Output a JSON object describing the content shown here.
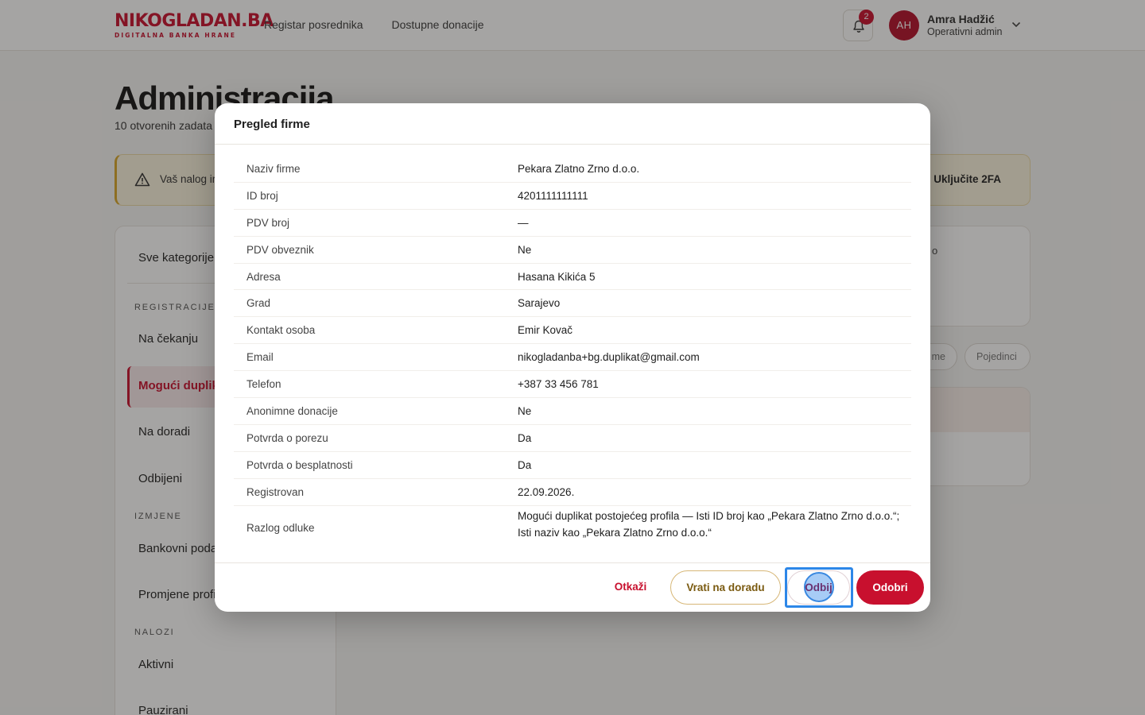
{
  "header": {
    "logo_main_a": "NIKO",
    "logo_main_b": "GLADAN.BA",
    "logo_sub": "DIGITALNA BANKA HRANE",
    "nav": [
      "Registar posrednika",
      "Dostupne donacije"
    ],
    "notifications_count": "2",
    "user_initials": "AH",
    "user_name": "Amra Hadžić",
    "user_role": "Operativni admin"
  },
  "page": {
    "title": "Administracija",
    "subtitle": "10 otvorenih zadata",
    "alert_text": "Vaš nalog ir",
    "alert_action": "Uključite 2FA"
  },
  "sidebar": {
    "all": "Sve kategorije",
    "section_registracije": "REGISTRACIJE",
    "item_na_cekanju": "Na čekanju",
    "item_moguci_duplikati": "Mogući duplika",
    "item_na_doradi": "Na doradi",
    "item_odbijeni": "Odbijeni",
    "section_izmjene": "IZMJENE",
    "item_bankovni": "Bankovni poda",
    "item_promjene": "Promjene profi",
    "section_nalozi": "NALOZI",
    "item_aktivni": "Aktivni",
    "item_pauzirani": "Pauzirani"
  },
  "right": {
    "card_text": "o",
    "chip1": "me",
    "chip2": "Pojedinci"
  },
  "modal": {
    "title": "Pregled firme",
    "rows": [
      {
        "k": "Naziv firme",
        "v": "Pekara Zlatno Zrno d.o.o."
      },
      {
        "k": "ID broj",
        "v": "4201111111111"
      },
      {
        "k": "PDV broj",
        "v": "—"
      },
      {
        "k": "PDV obveznik",
        "v": "Ne"
      },
      {
        "k": "Adresa",
        "v": "Hasana Kikića 5"
      },
      {
        "k": "Grad",
        "v": "Sarajevo"
      },
      {
        "k": "Kontakt osoba",
        "v": "Emir Kovač"
      },
      {
        "k": "Email",
        "v": "nikogladanba+bg.duplikat@gmail.com"
      },
      {
        "k": "Telefon",
        "v": "+387 33 456 781"
      },
      {
        "k": "Anonimne donacije",
        "v": "Ne"
      },
      {
        "k": "Potvrda o porezu",
        "v": "Da"
      },
      {
        "k": "Potvrda o besplatnosti",
        "v": "Da"
      },
      {
        "k": "Registrovan",
        "v": "22.09.2026."
      },
      {
        "k": "Razlog odluke",
        "v": "Mogući duplikat postojećeg profila — Isti ID broj kao „Pekara Zlatno Zrno d.o.o.“; Isti naziv kao „Pekara Zlatno Zrno d.o.o.“"
      }
    ],
    "btn_cancel": "Otkaži",
    "btn_rework": "Vrati na doradu",
    "btn_reject": "Odbij",
    "btn_approve": "Odobri"
  }
}
